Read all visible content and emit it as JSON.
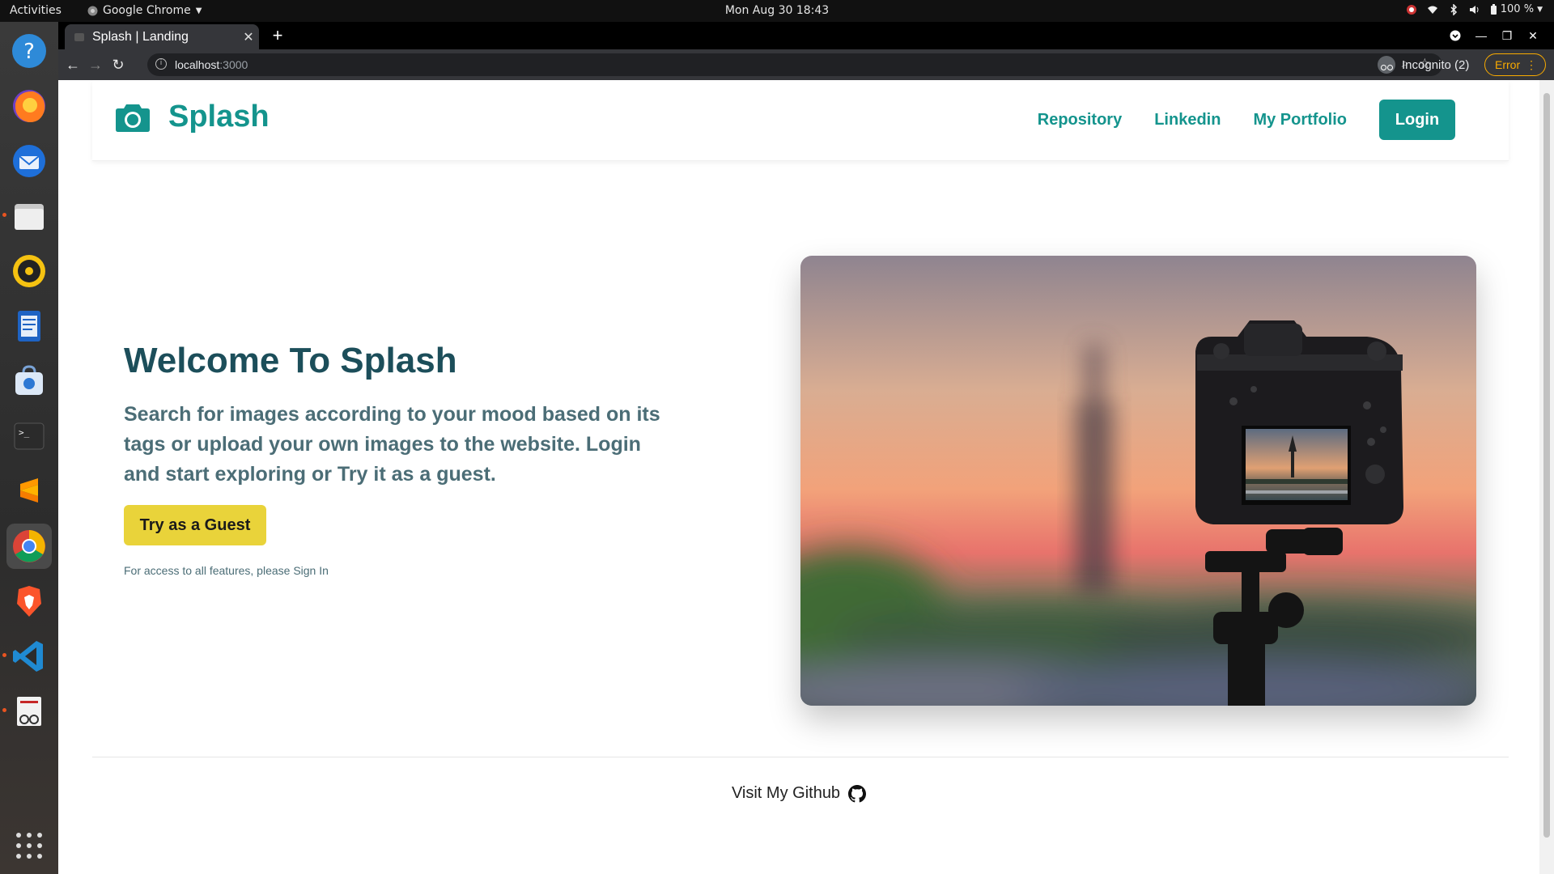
{
  "topbar": {
    "activities": "Activities",
    "app_name": "Google Chrome",
    "clock": "Mon Aug 30  18:43",
    "battery": "100 %"
  },
  "dock": {
    "apps": [
      "help-icon",
      "firefox-icon",
      "thunderbird-icon",
      "files-icon",
      "rhythmbox-icon",
      "writer-icon",
      "software-icon",
      "terminal-icon",
      "sublime-icon",
      "chrome-icon",
      "brave-icon",
      "vscode-icon",
      "screenshot-viewer-icon"
    ]
  },
  "browser": {
    "tab_title": "Splash | Landing",
    "url_host": "localhost",
    "url_port": ":3000",
    "incognito_label": "Incognito (2)",
    "error_label": "Error"
  },
  "site": {
    "brand": "Splash",
    "nav": {
      "repository": "Repository",
      "linkedin": "Linkedin",
      "portfolio": "My Portfolio",
      "login": "Login"
    },
    "hero": {
      "title": "Welcome To Splash",
      "text": "Search for images according to your mood based on its tags or upload your own images to the website. Login and start exploring or Try it as a guest.",
      "guest_button": "Try as a Guest",
      "note": "For access to all features, please Sign In"
    },
    "footer": {
      "github_link": "Visit My Github"
    }
  },
  "colors": {
    "accent": "#14948d",
    "guest_button": "#e9d33a",
    "heading": "#1c4e5a"
  }
}
